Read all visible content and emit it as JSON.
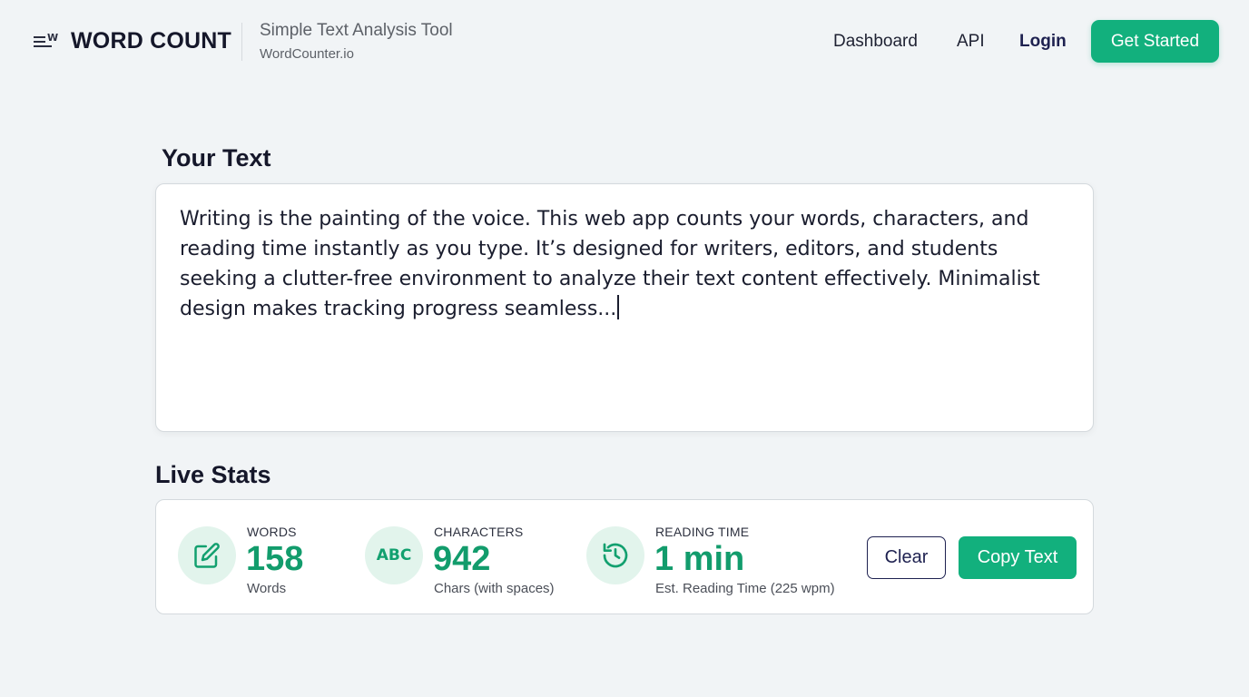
{
  "header": {
    "logo_text": "WORD COUNT",
    "subtitle": "Simple Text Analysis Tool",
    "domain": "WordCounter.io",
    "nav": {
      "dashboard": "Dashboard",
      "api": "API",
      "login": "Login"
    },
    "cta_label": "Get Started"
  },
  "editor": {
    "section_title": "Your Text",
    "text": "Writing is the painting of the voice. This web app counts your words, characters, and reading time instantly as you type. It’s designed for writers, editors, and students seeking a clutter-free environment to analyze their text content effectively. Minimalist design makes tracking progress seamless..."
  },
  "stats": {
    "section_title": "Live Stats",
    "words": {
      "label": "WORDS",
      "value": "158",
      "sub": "Words",
      "icon": "edit-icon"
    },
    "characters": {
      "label": "CHARACTERS",
      "value": "942",
      "sub": "Chars (with spaces)",
      "icon_text": "ABC"
    },
    "reading_time": {
      "label": "READING TIME",
      "value": "1 min",
      "sub": "Est. Reading Time (225 wpm)",
      "icon": "clock-history-icon"
    },
    "clear_label": "Clear",
    "copy_label": "Copy Text"
  },
  "colors": {
    "accent": "#12b07d",
    "accent_dark": "#129c6c",
    "navy": "#1e2150",
    "background": "#f1f4f6"
  }
}
